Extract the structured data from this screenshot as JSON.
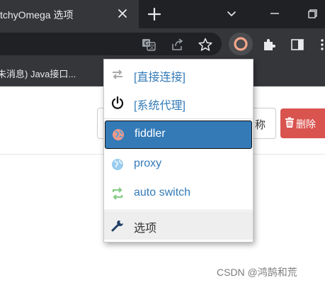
{
  "tab": {
    "title": "tchyOmega 选项"
  },
  "bookmarks": {
    "item1": "未消息) Java接口..."
  },
  "page": {
    "input_text": "称",
    "delete_label": "删除"
  },
  "menu": {
    "items": [
      {
        "label": "[直接连接]",
        "icon": "direct-connect-icon"
      },
      {
        "label": "[系统代理]",
        "icon": "power-icon"
      },
      {
        "label": "fiddler",
        "icon": "globe-icon",
        "selected": true
      },
      {
        "label": "proxy",
        "icon": "globe-icon"
      },
      {
        "label": "auto switch",
        "icon": "retweet-icon"
      },
      {
        "label": "选项",
        "icon": "wrench-icon"
      }
    ]
  },
  "watermark": "CSDN @鸿鹄和荒",
  "colors": {
    "accent": "#337ab7",
    "danger": "#d9534f",
    "chrome_dark": "#202124",
    "chrome_toolbar": "#35363a",
    "auto_switch_green": "#88cc88",
    "proxy_globe": "#99ccee",
    "fiddler_globe": "#ee9988"
  }
}
